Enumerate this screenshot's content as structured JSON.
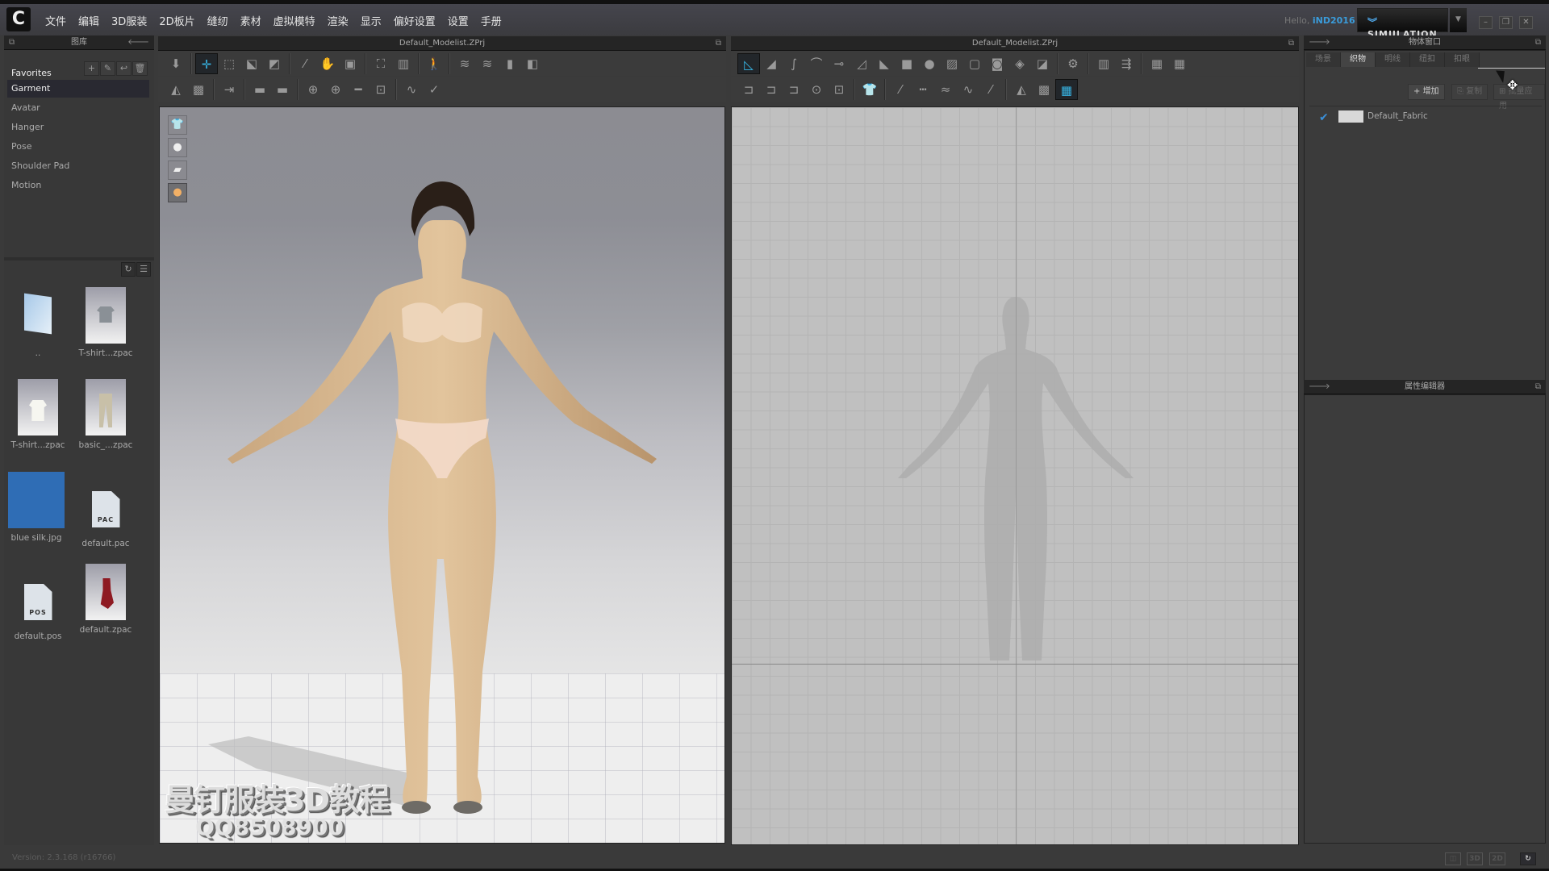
{
  "app": {
    "logo_glyph": "C",
    "menu": [
      "文件",
      "编辑",
      "3D服装",
      "2D板片",
      "缝纫",
      "素材",
      "虚拟模特",
      "渲染",
      "显示",
      "偏好设置",
      "设置",
      "手册"
    ],
    "greeting": "Hello,",
    "username": "iND2016",
    "mode_button": "SIMULATION",
    "mode_icon": "double-chevron-down",
    "window_controls": {
      "minimize": "–",
      "restore": "❐",
      "close": "✕"
    }
  },
  "library": {
    "title": "图库",
    "favorites_label": "Favorites",
    "categories": [
      {
        "label": "Garment",
        "selected": true
      },
      {
        "label": "Avatar",
        "selected": false
      },
      {
        "label": "Hanger",
        "selected": false
      },
      {
        "label": "Pose",
        "selected": false
      },
      {
        "label": "Shoulder Pad",
        "selected": false
      },
      {
        "label": "Motion",
        "selected": false
      }
    ],
    "favorite_tools": [
      "add",
      "edit",
      "back",
      "delete"
    ],
    "files": [
      {
        "name": "..",
        "type": "folder"
      },
      {
        "name": "T-shirt...zpac",
        "type": "garment-gray-tshirt"
      },
      {
        "name": "T-shirt...zpac",
        "type": "garment-white-tshirt"
      },
      {
        "name": "basic_...zpac",
        "type": "garment-pants"
      },
      {
        "name": "blue silk.jpg",
        "type": "image",
        "color": "#2f6db5"
      },
      {
        "name": "default.pac",
        "type": "doc",
        "badge": "PAC"
      },
      {
        "name": "default.pos",
        "type": "doc",
        "badge": "POS"
      },
      {
        "name": "default.zpac",
        "type": "garment-red-dress"
      }
    ]
  },
  "view3d": {
    "title": "Default_Modelist.ZPrj",
    "toolbar_row1": [
      "down-arrow",
      "select-move",
      "select-box",
      "transform-box",
      "fold-arrange",
      "pin",
      "fabric-brush",
      "garment-edit",
      "arrange-sides",
      "arrange-fold",
      "avatar-walk",
      "layer-up",
      "layer-down",
      "superimpose",
      "superimpose-sides"
    ],
    "toolbar_row2": [
      "avatar-measure",
      "texture-edit",
      "tack",
      "strengthen",
      "strengthen-2",
      "button-select",
      "button",
      "button-hole",
      "button-lock",
      "fit-map",
      "measure-fit"
    ],
    "view_icons": [
      "show-garment",
      "show-avatar",
      "show-fabric",
      "show-skin"
    ],
    "watermark_line1": "曼钉服装3D教程",
    "watermark_line2": "QQ8508900"
  },
  "view2d": {
    "title": "Default_Modelist.ZPrj",
    "toolbar_row1": [
      "transform-pattern",
      "edit-point",
      "edit-curve",
      "curve-point",
      "add-point",
      "edit-shape",
      "polygon",
      "rectangle",
      "circle",
      "internal-polygon",
      "internal-rectangle",
      "internal-circle",
      "dart",
      "trace",
      "pattern-tool",
      "lock",
      "segment",
      "select-grid",
      "grid-show"
    ],
    "toolbar_row2": [
      "sew-segment",
      "sew-free",
      "sew-multi",
      "sew-check",
      "sew-edit",
      "garment-fit",
      "topstitch-select",
      "topstitch-segment",
      "topstitch-free",
      "topstitch-multi",
      "topstitch-view",
      "avatar-measure",
      "texture",
      "show-checker"
    ]
  },
  "object_browser": {
    "title": "物体窗口",
    "tabs": [
      {
        "label": "场景",
        "selected": false
      },
      {
        "label": "织物",
        "selected": true
      },
      {
        "label": "明线",
        "selected": false
      },
      {
        "label": "纽扣",
        "selected": false
      },
      {
        "label": "扣眼",
        "selected": false
      }
    ],
    "buttons": {
      "add": "增加",
      "copy": "复制",
      "apply": "批量应用"
    },
    "fabrics": [
      {
        "name": "Default_Fabric",
        "checked": true,
        "swatch": "#d8d8d8"
      }
    ]
  },
  "property_editor": {
    "title": "属性编辑器"
  },
  "statusbar": {
    "version": "Version: 2.3.168    (r16766)",
    "layout_buttons": [
      "split",
      "3D",
      "2D"
    ],
    "refresh_icon": "↻"
  }
}
